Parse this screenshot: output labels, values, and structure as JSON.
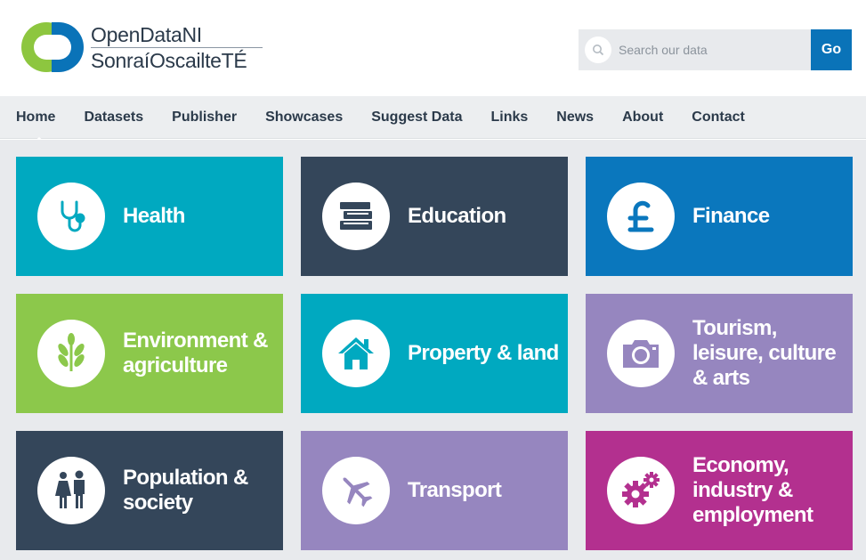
{
  "logo": {
    "line1": "OpenDataNI",
    "line2": "SonraíOscailteTÉ",
    "colors": {
      "green": "#8dc63f",
      "blue": "#0a73b8"
    }
  },
  "search": {
    "placeholder": "Search our data",
    "button_label": "Go"
  },
  "nav": {
    "items": [
      {
        "label": "Home",
        "active": true
      },
      {
        "label": "Datasets"
      },
      {
        "label": "Publisher"
      },
      {
        "label": "Showcases"
      },
      {
        "label": "Suggest Data"
      },
      {
        "label": "Links"
      },
      {
        "label": "News"
      },
      {
        "label": "About"
      },
      {
        "label": "Contact"
      }
    ]
  },
  "categories": [
    {
      "label": "Health",
      "icon": "stethoscope-icon",
      "color": "#00a9c0"
    },
    {
      "label": "Education",
      "icon": "books-icon",
      "color": "#34465a"
    },
    {
      "label": "Finance",
      "icon": "pound-icon",
      "color": "#0a77bd"
    },
    {
      "label": "Environment & agriculture",
      "icon": "plant-icon",
      "color": "#8cc84b"
    },
    {
      "label": "Property & land",
      "icon": "house-icon",
      "color": "#00a9c0"
    },
    {
      "label": "Tourism, leisure, culture & arts",
      "icon": "camera-icon",
      "color": "#9686bf"
    },
    {
      "label": "Population & society",
      "icon": "people-icon",
      "color": "#34465a"
    },
    {
      "label": "Transport",
      "icon": "plane-icon",
      "color": "#9686bf"
    },
    {
      "label": "Economy, industry & employment",
      "icon": "gears-icon",
      "color": "#b3308f"
    }
  ]
}
